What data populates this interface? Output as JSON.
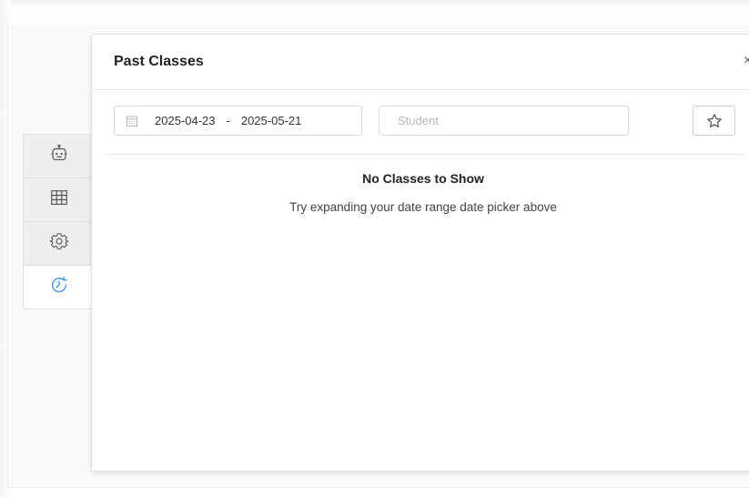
{
  "panel": {
    "title": "Past Classes",
    "close_label": "×"
  },
  "filters": {
    "date_start": "2025-04-23",
    "date_separator": "-",
    "date_end": "2025-05-21",
    "student_placeholder": "Student",
    "student_value": ""
  },
  "empty_state": {
    "title": "No Classes to Show",
    "message": "Try expanding your date range date picker above"
  },
  "side_tabs": [
    {
      "icon": "robot-icon",
      "active": false
    },
    {
      "icon": "grid-icon",
      "active": false
    },
    {
      "icon": "gear-icon",
      "active": false
    },
    {
      "icon": "history-icon",
      "active": true
    }
  ],
  "colors": {
    "accent": "#3d8fe0",
    "tab_background": "#eeeeee",
    "panel_border": "#e0e0e0"
  }
}
